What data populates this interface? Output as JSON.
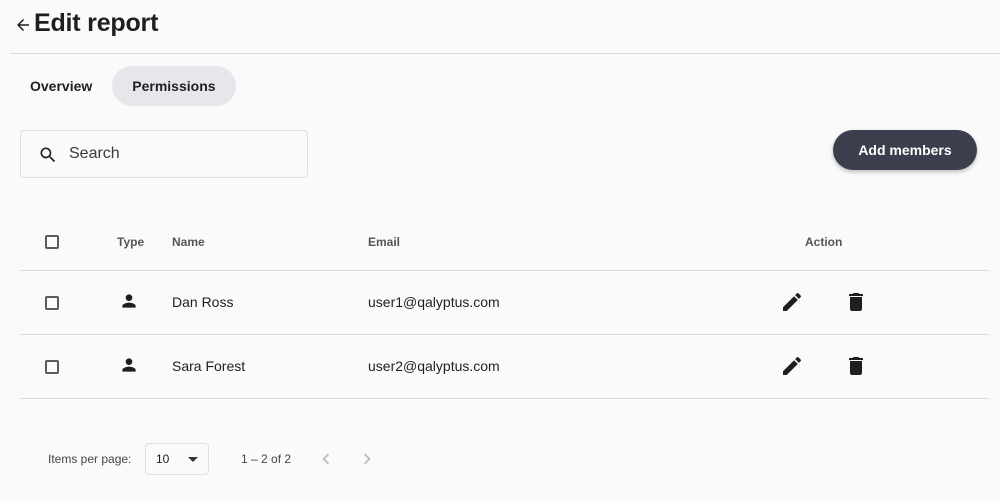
{
  "header": {
    "back_icon": "arrow-back-icon",
    "title": "Edit report"
  },
  "tabs": [
    {
      "label": "Overview",
      "active": false
    },
    {
      "label": "Permissions",
      "active": true
    }
  ],
  "search": {
    "icon": "search-icon",
    "placeholder": "Search",
    "value": ""
  },
  "toolbar": {
    "add_members_label": "Add members"
  },
  "table": {
    "columns": {
      "select": "",
      "type": "Type",
      "name": "Name",
      "email": "Email",
      "action": "Action"
    },
    "rows": [
      {
        "type_icon": "person-icon",
        "name": "Dan Ross",
        "email": "user1@qalyptus.com",
        "checked": false
      },
      {
        "type_icon": "person-icon",
        "name": "Sara Forest",
        "email": "user2@qalyptus.com",
        "checked": false
      }
    ],
    "action_icons": [
      "edit-icon",
      "delete-icon"
    ]
  },
  "paginator": {
    "items_per_page_label": "Items per page:",
    "page_size": "10",
    "range_label": "1 – 2 of 2",
    "prev_icon": "chevron-left-icon",
    "next_icon": "chevron-right-icon"
  },
  "colors": {
    "background": "#fafafa",
    "active_tab": "#e5e7ea",
    "primary_button": "#3b3f4d",
    "divider": "#dcdcdc"
  }
}
